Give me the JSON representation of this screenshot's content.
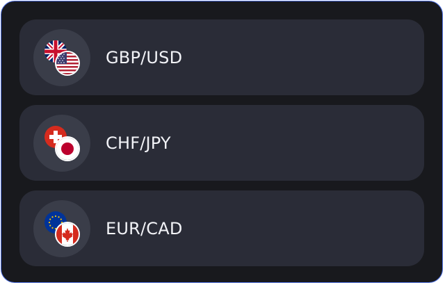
{
  "colors": {
    "panel_background": "#18191d",
    "panel_border": "#4d6fe0",
    "row_background": "#2a2c37",
    "badge_background": "#3a3d49",
    "label_text": "#f2f3f7"
  },
  "pairs": [
    {
      "label": "GBP/USD",
      "base_flag": "uk-flag-icon",
      "quote_flag": "us-flag-icon"
    },
    {
      "label": "CHF/JPY",
      "base_flag": "switzerland-flag-icon",
      "quote_flag": "japan-flag-icon"
    },
    {
      "label": "EUR/CAD",
      "base_flag": "eu-flag-icon",
      "quote_flag": "canada-flag-icon"
    }
  ]
}
